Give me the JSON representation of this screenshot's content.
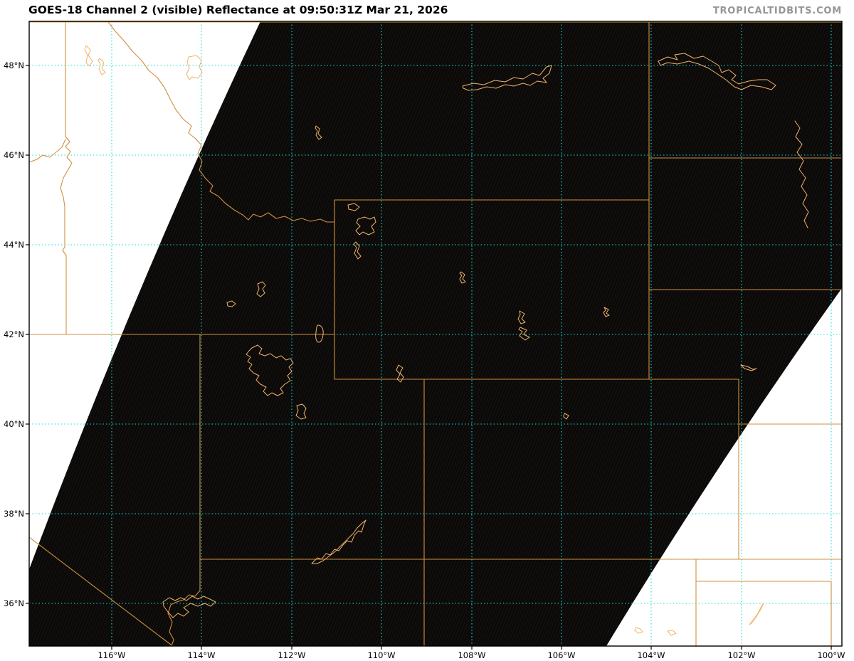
{
  "header": {
    "title": "GOES-18 Channel 2 (visible) Reflectance at 09:50:31Z Mar 21, 2026",
    "watermark": "TROPICALTIDBITS.COM"
  },
  "map": {
    "satellite": "GOES-18",
    "channel": "Channel 2 (visible)",
    "product": "Reflectance",
    "valid_time": "09:50:31Z Mar 21, 2026",
    "lat_ticks": [
      "48°N",
      "46°N",
      "44°N",
      "42°N",
      "40°N",
      "38°N",
      "36°N"
    ],
    "lon_ticks": [
      "116°W",
      "114°W",
      "112°W",
      "110°W",
      "108°W",
      "106°W",
      "104°W",
      "102°W",
      "100°W"
    ],
    "colors": {
      "gridline": "#10ddd6",
      "state_border": "#cf9040",
      "water_outline": "#f1b269",
      "data_region": "#0a0908",
      "no_data_region": "#ffffff",
      "axis": "#000000",
      "watermark_text": "#969696"
    }
  }
}
